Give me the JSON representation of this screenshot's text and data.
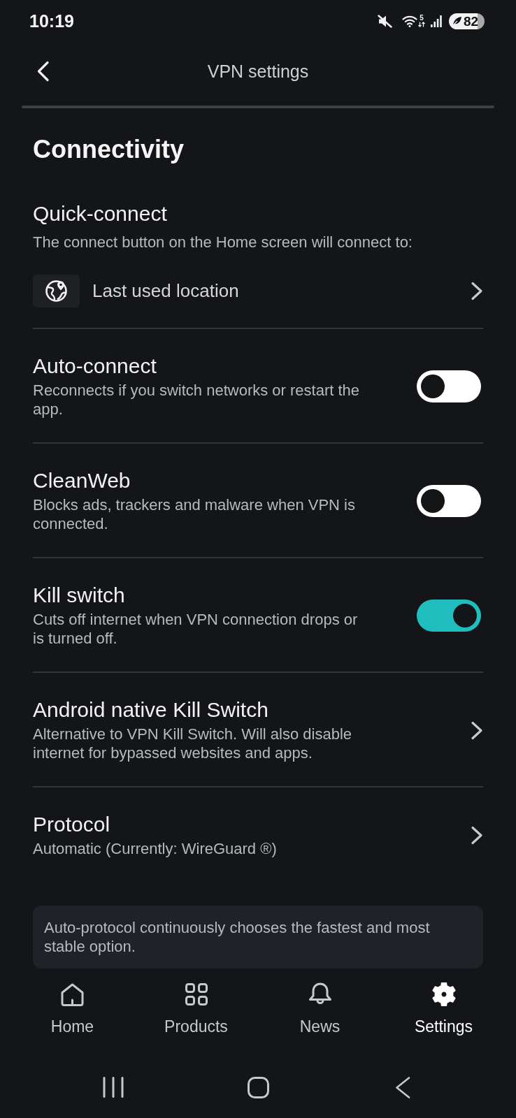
{
  "status_bar": {
    "time": "10:19",
    "network_band": "5",
    "battery": "82"
  },
  "header": {
    "title": "VPN settings"
  },
  "section_title": "Connectivity",
  "quick_connect": {
    "title": "Quick-connect",
    "description": "The connect button on the Home screen will connect to:",
    "location": "Last used location"
  },
  "settings": [
    {
      "kind": "toggle",
      "title": "Auto-connect",
      "description": "Reconnects if you switch networks or restart the app.",
      "on": false
    },
    {
      "kind": "toggle",
      "title": "CleanWeb",
      "description": "Blocks ads, trackers and malware when VPN is connected.",
      "on": false
    },
    {
      "kind": "toggle",
      "title": "Kill switch",
      "description": "Cuts off internet when VPN connection drops or is turned off.",
      "on": true
    },
    {
      "kind": "link",
      "title": "Android native Kill Switch",
      "description": "Alternative to VPN Kill Switch. Will also disable internet for bypassed websites and apps."
    },
    {
      "kind": "link",
      "title": "Protocol",
      "description": "Automatic (Currently: WireGuard ®)",
      "note": "Auto-protocol continuously chooses the fastest and most stable option."
    }
  ],
  "bottom_nav": [
    {
      "label": "Home",
      "selected": false
    },
    {
      "label": "Products",
      "selected": false
    },
    {
      "label": "News",
      "selected": false
    },
    {
      "label": "Settings",
      "selected": true
    }
  ]
}
